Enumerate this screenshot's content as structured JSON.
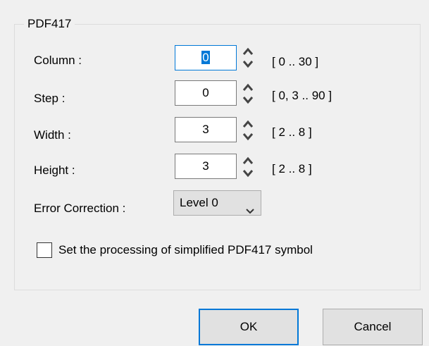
{
  "group": {
    "title": "PDF417"
  },
  "fields": [
    {
      "label": "Column :",
      "value": "0",
      "range": "[ 0 .. 30 ]"
    },
    {
      "label": "Step :",
      "value": "0",
      "range": "[ 0, 3 .. 90 ]"
    },
    {
      "label": "Width :",
      "value": "3",
      "range": "[ 2 .. 8 ]"
    },
    {
      "label": "Height :",
      "value": "3",
      "range": "[ 2 .. 8 ]"
    }
  ],
  "error_correction": {
    "label": "Error Correction :",
    "selected": "Level 0"
  },
  "simplified": {
    "label": "Set the processing of simplified PDF417 symbol",
    "checked": false
  },
  "buttons": {
    "ok": "OK",
    "cancel": "Cancel"
  },
  "icons": {
    "spinner": "up-down-chevrons-icon",
    "dropdown": "chevron-down-icon"
  },
  "colors": {
    "focus": "#0078d7",
    "background": "#f0f0f0"
  }
}
